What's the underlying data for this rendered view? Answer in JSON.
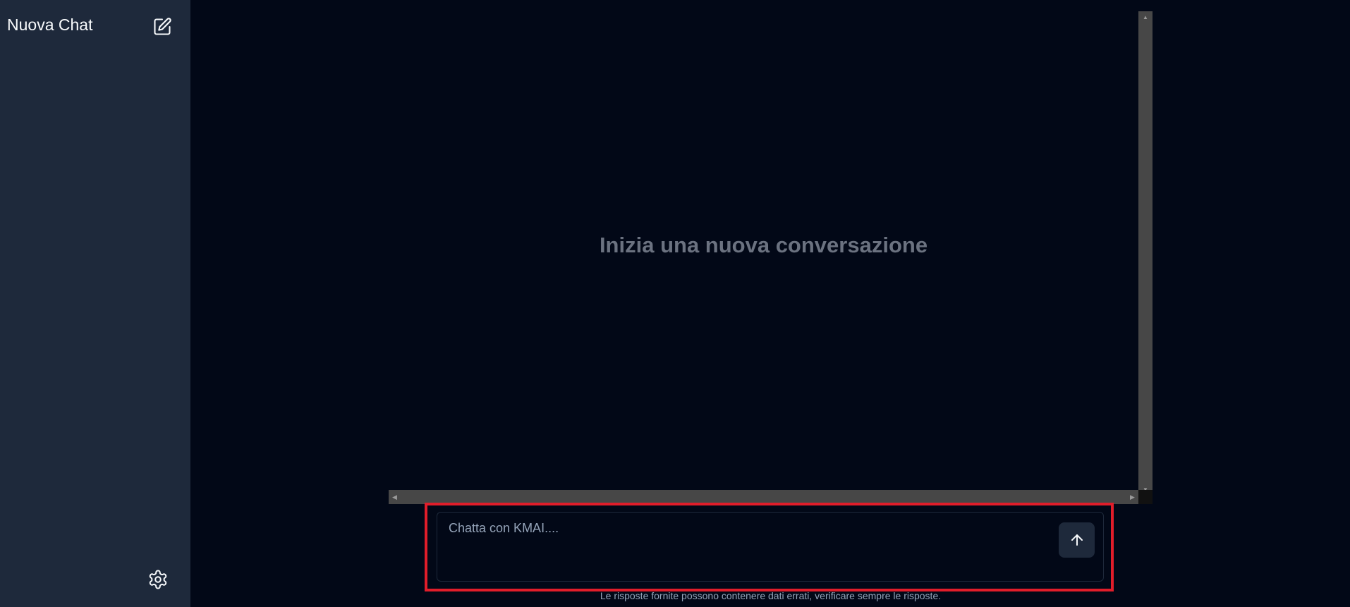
{
  "sidebar": {
    "title": "Nuova Chat",
    "new_chat_icon": "edit-icon",
    "settings_icon": "gear-icon"
  },
  "chat": {
    "empty_state": "Inizia una nuova conversazione"
  },
  "composer": {
    "placeholder": "Chatta con KMAI....",
    "value": "",
    "send_icon": "arrow-up-icon"
  },
  "footer": {
    "disclaimer": "Le risposte fornite possono contenere dati errati, verificare sempre le risposte."
  },
  "colors": {
    "background": "#020817",
    "sidebar": "#1e293b",
    "highlight": "#e11d2a"
  }
}
